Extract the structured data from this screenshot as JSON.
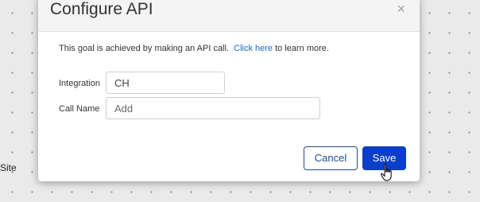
{
  "background": {
    "partial_label": "Site"
  },
  "modal": {
    "title": "Configure API",
    "close_glyph": "×",
    "description": "This goal is achieved by making an API call.",
    "link_text": "Click here",
    "link_suffix": "to learn more."
  },
  "form": {
    "integration": {
      "label": "Integration",
      "value": "CH"
    },
    "call_name": {
      "label": "Call Name",
      "placeholder": "Add"
    }
  },
  "buttons": {
    "cancel": "Cancel",
    "save": "Save"
  },
  "colors": {
    "primary": "#0b3fc9",
    "link": "#1a6bb5",
    "cancel_border": "#1f4d8c"
  },
  "icons": {
    "close": "close-icon",
    "pointer": "hand-pointer-icon"
  }
}
